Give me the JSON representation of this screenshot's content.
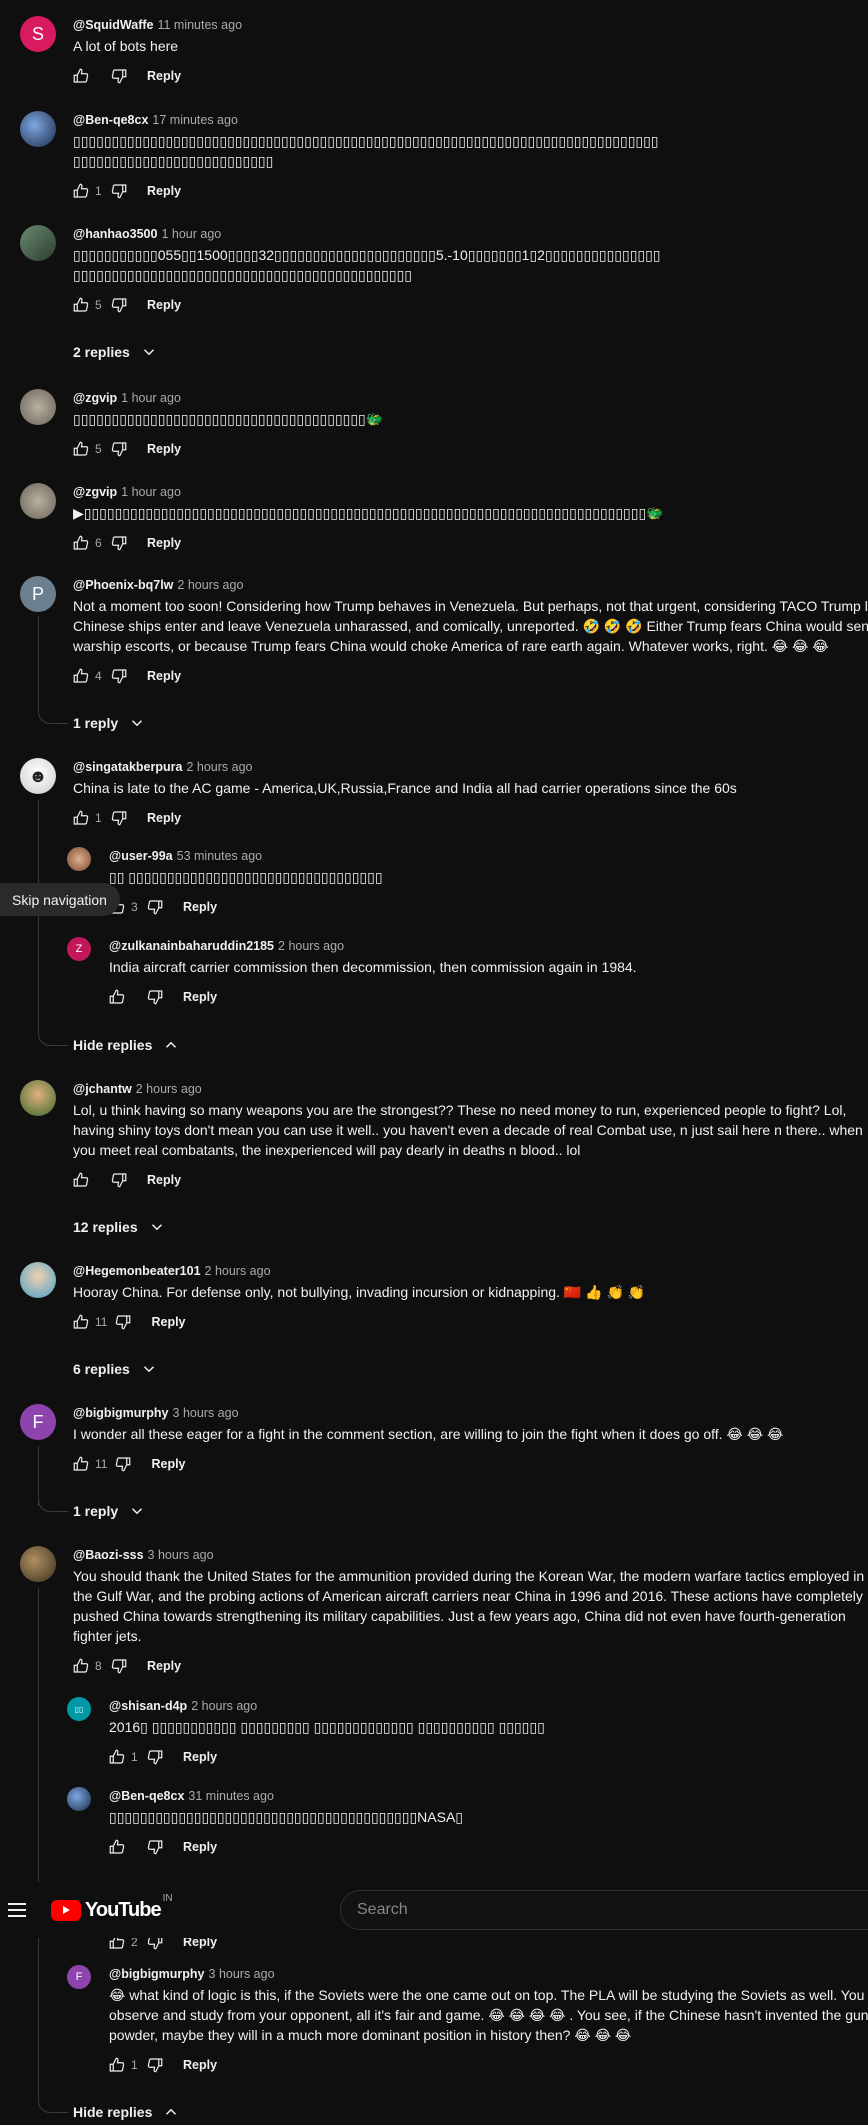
{
  "masthead": {
    "logo_text": "YouTube",
    "country_code": "IN",
    "search_placeholder": "Search"
  },
  "skip_nav": "Skip navigation",
  "common": {
    "reply": "Reply"
  },
  "comments": [
    {
      "id": "c1",
      "handle": "@SquidWaffe",
      "time": "11 minutes ago",
      "avatar": "S",
      "avatar_color": "#d81b60",
      "text": "A lot of bots here",
      "likes": ""
    },
    {
      "id": "c2",
      "handle": "@Ben-qe8cx",
      "time": "17 minutes ago",
      "avatar": "",
      "avatar_color": "#1a2a4a",
      "text": "▯▯▯▯▯▯▯▯▯▯▯▯▯▯▯▯▯▯▯▯▯▯▯▯▯▯▯▯▯▯▯▯▯▯▯▯▯▯▯▯▯▯▯▯▯▯▯▯▯▯▯▯▯▯▯▯▯▯▯▯▯▯▯▯▯▯▯▯▯▯▯▯▯▯▯▯",
      "text2": "▯▯▯▯▯▯▯▯▯▯▯▯▯▯▯▯▯▯▯▯▯▯▯▯▯▯",
      "likes": "1"
    },
    {
      "id": "c3",
      "handle": "@hanhao3500",
      "time": "1 hour ago",
      "avatar": "",
      "avatar_color": "#3c5a44",
      "text": "▯▯▯▯▯▯▯▯▯▯▯055▯▯1500▯▯▯▯32▯▯▯▯▯▯▯▯▯▯▯▯▯▯▯▯▯▯▯▯▯5.-10▯▯▯▯▯▯▯1▯2▯▯▯▯▯▯▯▯▯▯▯▯▯▯▯",
      "text2": "▯▯▯▯▯▯▯▯▯▯▯▯▯▯▯▯▯▯▯▯▯▯▯▯▯▯▯▯▯▯▯▯▯▯▯▯▯▯▯▯▯▯▯▯",
      "likes": "5",
      "replies_toggle": "2 replies"
    },
    {
      "id": "c4",
      "handle": "@zgvip",
      "time": "1 hour ago",
      "avatar": "",
      "avatar_color": "#8a8478",
      "text": "▯▯▯▯▯▯▯▯▯▯▯▯▯▯▯▯▯▯▯▯▯▯▯▯▯▯▯▯▯▯▯▯▯▯▯▯▯▯🐲",
      "likes": "5"
    },
    {
      "id": "c5",
      "handle": "@zgvip",
      "time": "1 hour ago",
      "avatar": "",
      "avatar_color": "#8a8478",
      "text": "▶▯▯▯▯▯▯▯▯▯▯▯▯▯▯▯▯▯▯▯▯▯▯▯▯▯▯▯▯▯▯▯▯▯▯▯▯▯▯▯▯▯▯▯▯▯▯▯▯▯▯▯▯▯▯▯▯▯▯▯▯▯▯▯▯▯▯▯▯▯▯▯▯▯🐲",
      "likes": "6"
    },
    {
      "id": "c6",
      "handle": "@Phoenix-bq7lw",
      "time": "2 hours ago",
      "avatar": "P",
      "avatar_color": "#6c7f8f",
      "text": "Not a moment too soon! Considering how Trump behaves in Venezuela. But perhaps, not that urgent, considering TACO Trump le",
      "text2": "Chinese ships enter and leave Venezuela unharassed, and comically,  unreported. 🤣 🤣 🤣 Either Trump fears China would send",
      "text3": "warship escorts, or because Trump fears China would choke America of rare earth again. Whatever works, right. 😂 😂 😂",
      "likes": "4",
      "replies_toggle": "1 reply"
    },
    {
      "id": "c7",
      "handle": "@singatakberpura",
      "time": "2 hours ago",
      "avatar": "",
      "avatar_color": "#e8e8e8",
      "text": "China is late to the AC game - America,UK,Russia,France and India all had carrier operations since the 60s",
      "likes": "1",
      "replies": [
        {
          "handle": "@user-99a",
          "time": "53 minutes ago",
          "avatar": "",
          "avatar_color": "#b07a5a",
          "text": "▯▯ ▯▯▯▯▯▯▯▯▯▯▯▯▯▯▯▯▯▯▯▯▯▯▯▯▯▯▯▯▯▯▯▯▯",
          "likes": "3"
        },
        {
          "handle": "@zulkanainbaharuddin2185",
          "time": "2 hours ago",
          "avatar": "Z",
          "avatar_color": "#c2185b",
          "text": "India aircraft carrier commission then decommission, then commission again in 1984.",
          "likes": ""
        }
      ],
      "replies_toggle": "Hide replies"
    },
    {
      "id": "c8",
      "handle": "@jchantw",
      "time": "2 hours ago",
      "avatar": "",
      "avatar_color": "#4a6a3a",
      "text": "Lol, u think having so many weapons you are the strongest?? These no need money to run, experienced people to fight? Lol,",
      "text2": "having shiny toys don't mean you can use it well.. you haven't even a decade of real Combat use, n  just sail here n there.. when",
      "text3": "you meet real combatants, the inexperienced will pay dearly in deaths n blood.. lol",
      "likes": "",
      "replies_toggle": "12 replies"
    },
    {
      "id": "c9",
      "handle": "@Hegemonbeater101",
      "time": "2 hours ago",
      "avatar": "",
      "avatar_color": "#4aa0c8",
      "text": "Hooray China. For defense only, not bullying, invading  incursion or kidnapping. 🇨🇳 👍 👏 👏",
      "likes": "11",
      "replies_toggle": "6 replies"
    },
    {
      "id": "c10",
      "handle": "@bigbigmurphy",
      "time": "3 hours ago",
      "avatar": "F",
      "avatar_color": "#8e44ad",
      "text": "I wonder all these eager for a fight in the comment section, are willing to join the fight when it does go off. 😂 😂 😂",
      "likes": "11",
      "replies_toggle": "1 reply"
    },
    {
      "id": "c11",
      "handle": "@Baozi-sss",
      "time": "3 hours ago",
      "avatar": "",
      "avatar_color": "#5a4a30",
      "text": "You should thank the United States for the ammunition provided during the Korean War, the modern warfare tactics employed in",
      "text2": "the Gulf War, and the probing actions of American aircraft carriers near China in 1996 and 2016. These actions have completely",
      "text3": "pushed China towards strengthening its military capabilities. Just a few years ago, China did not even have fourth-generation",
      "text4": "fighter jets.",
      "likes": "8",
      "replies": [
        {
          "handle": "@shisan-d4p",
          "time": "2 hours ago",
          "avatar": "▯▯",
          "avatar_color": "#0097a7",
          "text": "2016▯ ▯▯▯▯▯▯▯▯▯▯▯  ▯▯▯▯▯▯▯▯▯  ▯▯▯▯▯▯▯▯▯▯▯▯▯  ▯▯▯▯▯▯▯▯▯▯  ▯▯▯▯▯▯",
          "likes": "1"
        },
        {
          "handle": "@Ben-qe8cx",
          "time": "31 minutes ago",
          "avatar": "",
          "avatar_color": "#1a2a4a",
          "text": "▯▯▯▯▯▯▯▯▯▯▯▯▯▯▯▯▯▯▯▯▯▯▯▯▯▯▯▯▯▯▯▯▯▯▯▯▯▯▯▯NASA▯",
          "likes": ""
        },
        {
          "handle": "",
          "time": "",
          "avatar": "",
          "avatar_color": "#555",
          "text": "",
          "likes": "2"
        },
        {
          "handle": "@bigbigmurphy",
          "time": "3 hours ago",
          "avatar": "F",
          "avatar_color": "#8e44ad",
          "text": "😂  what kind of logic is this, if the Soviets were the one came out on top. The PLA will be studying the Soviets as well. You",
          "text2": "observe and study from your opponent, all it's fair and game. 😂 😂 😂 😂 . You see, if the Chinese hasn't invented the gun",
          "text3": "powder, maybe they will in a much more dominant position in history then? 😂 😂 😂",
          "likes": "1"
        }
      ],
      "replies_toggle": "Hide replies"
    }
  ]
}
